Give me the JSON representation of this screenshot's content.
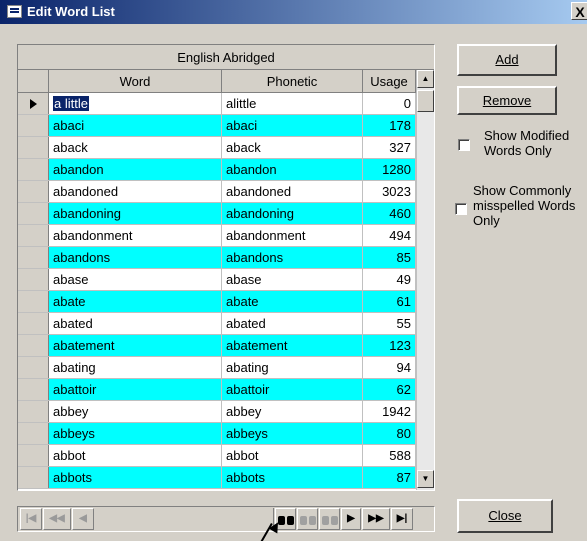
{
  "window": {
    "title": "Edit Word List",
    "close_label": "X"
  },
  "grid": {
    "caption": "English Abridged",
    "columns": {
      "word": "Word",
      "phonetic": "Phonetic",
      "usage": "Usage"
    },
    "rows": [
      {
        "word": "a little",
        "phonetic": "alittle",
        "usage": "0"
      },
      {
        "word": "abaci",
        "phonetic": "abaci",
        "usage": "178"
      },
      {
        "word": "aback",
        "phonetic": "aback",
        "usage": "327"
      },
      {
        "word": "abandon",
        "phonetic": "abandon",
        "usage": "1280"
      },
      {
        "word": "abandoned",
        "phonetic": "abandoned",
        "usage": "3023"
      },
      {
        "word": "abandoning",
        "phonetic": "abandoning",
        "usage": "460"
      },
      {
        "word": "abandonment",
        "phonetic": "abandonment",
        "usage": "494"
      },
      {
        "word": "abandons",
        "phonetic": "abandons",
        "usage": "85"
      },
      {
        "word": "abase",
        "phonetic": "abase",
        "usage": "49"
      },
      {
        "word": "abate",
        "phonetic": "abate",
        "usage": "61"
      },
      {
        "word": "abated",
        "phonetic": "abated",
        "usage": "55"
      },
      {
        "word": "abatement",
        "phonetic": "abatement",
        "usage": "123"
      },
      {
        "word": "abating",
        "phonetic": "abating",
        "usage": "94"
      },
      {
        "word": "abattoir",
        "phonetic": "abattoir",
        "usage": "62"
      },
      {
        "word": "abbey",
        "phonetic": "abbey",
        "usage": "1942"
      },
      {
        "word": "abbeys",
        "phonetic": "abbeys",
        "usage": "80"
      },
      {
        "word": "abbot",
        "phonetic": "abbot",
        "usage": "588"
      },
      {
        "word": "abbots",
        "phonetic": "abbots",
        "usage": "87"
      }
    ],
    "alt_row_color": "#00ffff",
    "selection_color": "#0a246a"
  },
  "buttons": {
    "add_label": "Add",
    "remove_label": "Remove",
    "close_label": "Close"
  },
  "options": {
    "show_modified": {
      "label": "Show Modified Words Only",
      "checked": false
    },
    "show_misspelled": {
      "label": "Show Commonly misspelled Words Only",
      "checked": false
    }
  },
  "navigator": {
    "first_icon": "first-record-icon",
    "prev_page_icon": "previous-page-icon",
    "prev_icon": "previous-record-icon",
    "find_icon": "find-binoculars-icon",
    "find_prev_icon": "find-previous-icon",
    "find_next_icon": "find-next-icon",
    "next_icon": "next-record-icon",
    "next_page_icon": "next-page-icon",
    "last_icon": "last-record-icon"
  }
}
